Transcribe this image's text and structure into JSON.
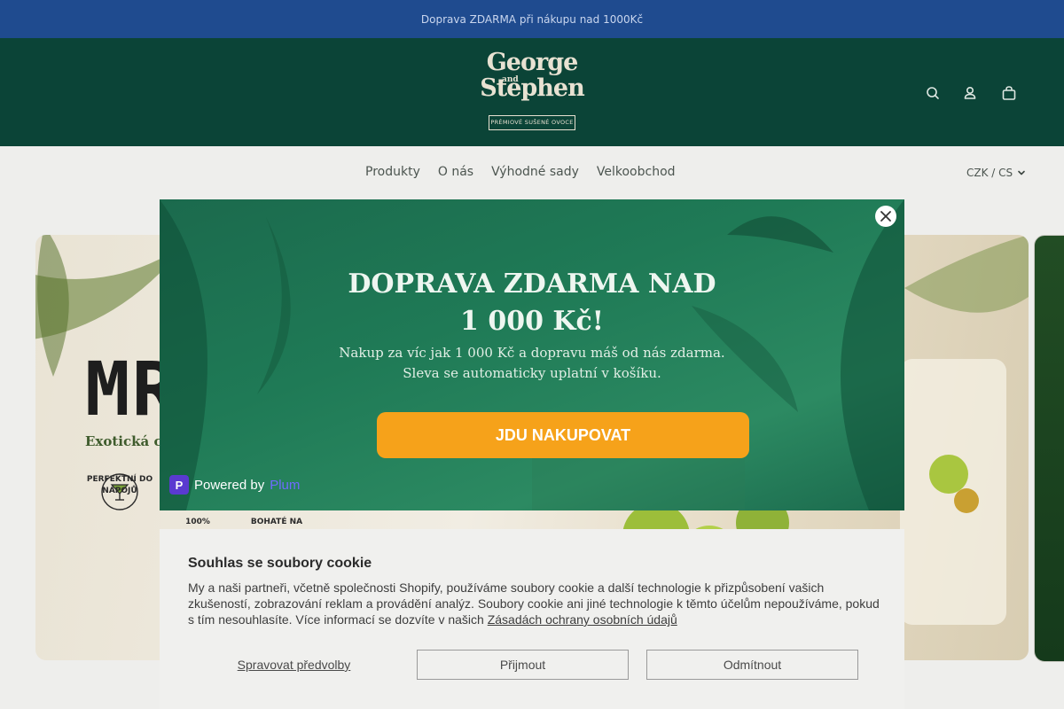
{
  "announcement": {
    "text": "Doprava ZDARMA při nákupu nad 1000Kč"
  },
  "logo": {
    "line1": "George",
    "and": "and",
    "line2": "Stephen",
    "tagline": "PRÉMIOVÉ SUŠENÉ OVOCE"
  },
  "header_icons": [
    "search-icon",
    "account-icon",
    "cart-icon"
  ],
  "nav": {
    "items": [
      "Produkty",
      "O nás",
      "Výhodné sady",
      "Velkoobchod"
    ],
    "currency": "CZK / CS"
  },
  "hero": {
    "brand": "MR.LIME",
    "subtitle": "Exotická chuť do každé doušek",
    "features": [
      "PERFEKTNÍ DO NÁPOJŮ",
      "100%",
      "BOHATÉ NA"
    ]
  },
  "popup": {
    "title_line1": "DOPRAVA ZDARMA NAD",
    "title_line2": "1 000 Kč!",
    "message_line1": "Nakup za víc jak 1 000 Kč a dopravu máš od nás zdarma.",
    "message_line2": "Sleva se automaticky uplatní v košíku.",
    "cta": "JDU NAKUPOVAT",
    "powered_by": "Powered by",
    "powered_name": "Plum"
  },
  "cookie": {
    "title": "Souhlas se soubory cookie",
    "text": "My a naši partneři, včetně společnosti Shopify, používáme soubory cookie a další technologie k přizpůsobení vašich zkušeností, zobrazování reklam a provádění analýz. Soubory cookie ani jiné technologie k těmto účelům nepoužíváme, pokud s tím nesouhlasíte. Více informací se dozvíte v našich",
    "link": "Zásadách ochrany osobních údajů",
    "manage": "Spravovat předvolby",
    "accept": "Přijmout",
    "decline": "Odmítnout"
  },
  "colors": {
    "header": "#0b4437",
    "announcement": "#1f4b8f",
    "cta": "#f6a21a",
    "popup": "#1f7a56"
  }
}
